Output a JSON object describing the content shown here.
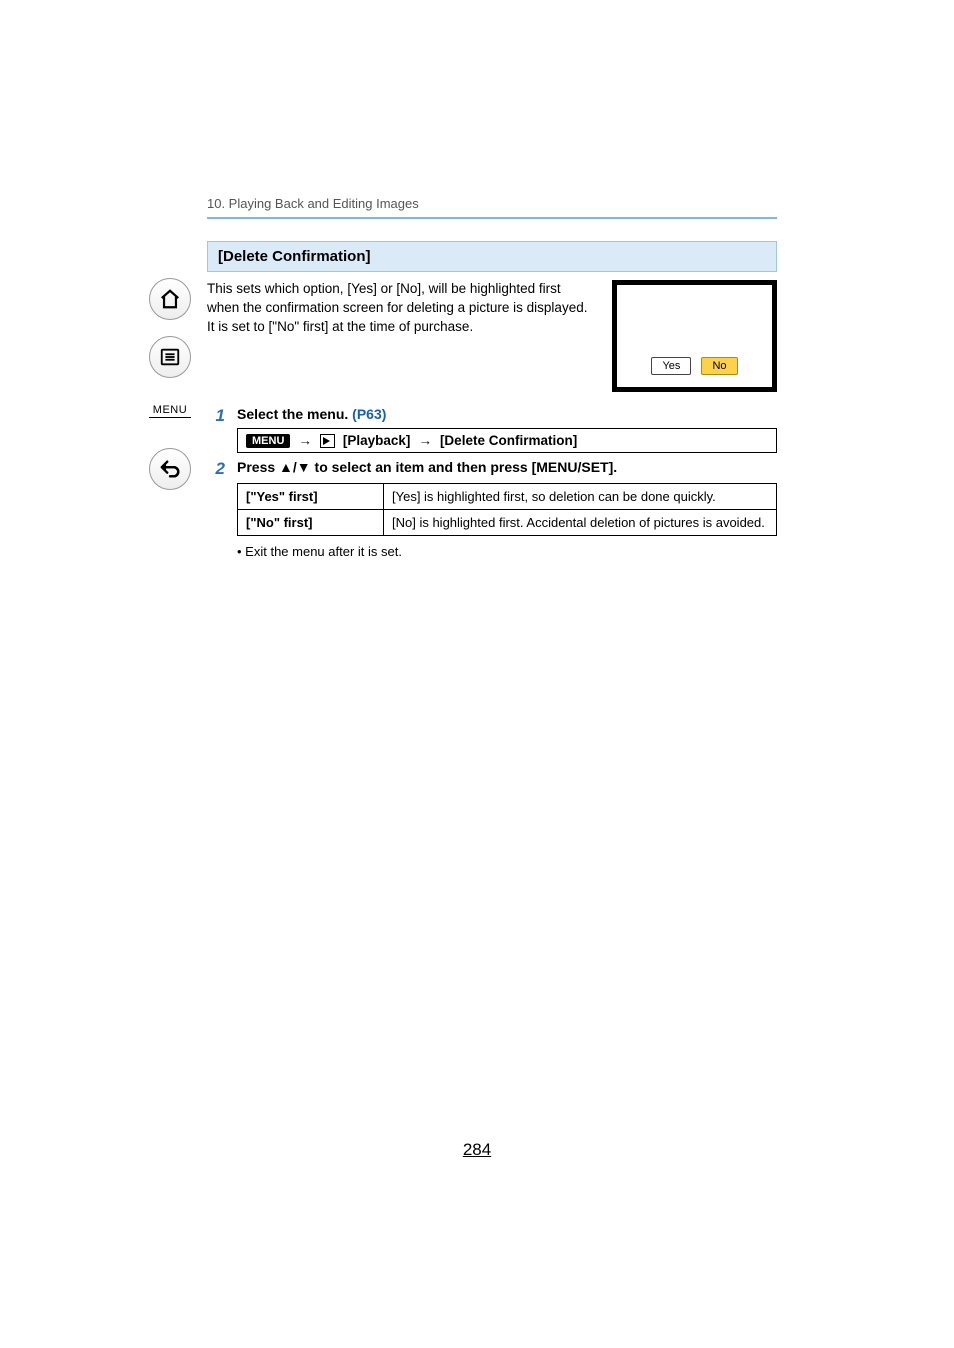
{
  "chapter": "10. Playing Back and Editing Images",
  "section_title": "[Delete Confirmation]",
  "intro_p1": "This sets which option, [Yes] or [No], will be highlighted first when the confirmation screen for deleting a picture is displayed.",
  "intro_p2": "It is set to [\"No\" first] at the time of purchase.",
  "dialog": {
    "yes": "Yes",
    "no": "No"
  },
  "sidenav": {
    "menu_label": "MENU"
  },
  "steps": {
    "s1": {
      "num": "1",
      "title_a": "Select the menu. ",
      "link": "(P63)",
      "menu_badge": "MENU",
      "arrow": "→",
      "path_a": " [Playback] ",
      "path_b": " [Delete Confirmation]"
    },
    "s2": {
      "num": "2",
      "title": "Press ▲/▼ to select an item and then press [MENU/SET].",
      "opt1_key": "[\"Yes\" first]",
      "opt1_val": "[Yes] is highlighted first, so deletion can be done quickly.",
      "opt2_key": "[\"No\" first]",
      "opt2_val": "[No] is highlighted first. Accidental deletion of pictures is avoided."
    }
  },
  "note": "Exit the menu after it is set.",
  "page_number": "284"
}
